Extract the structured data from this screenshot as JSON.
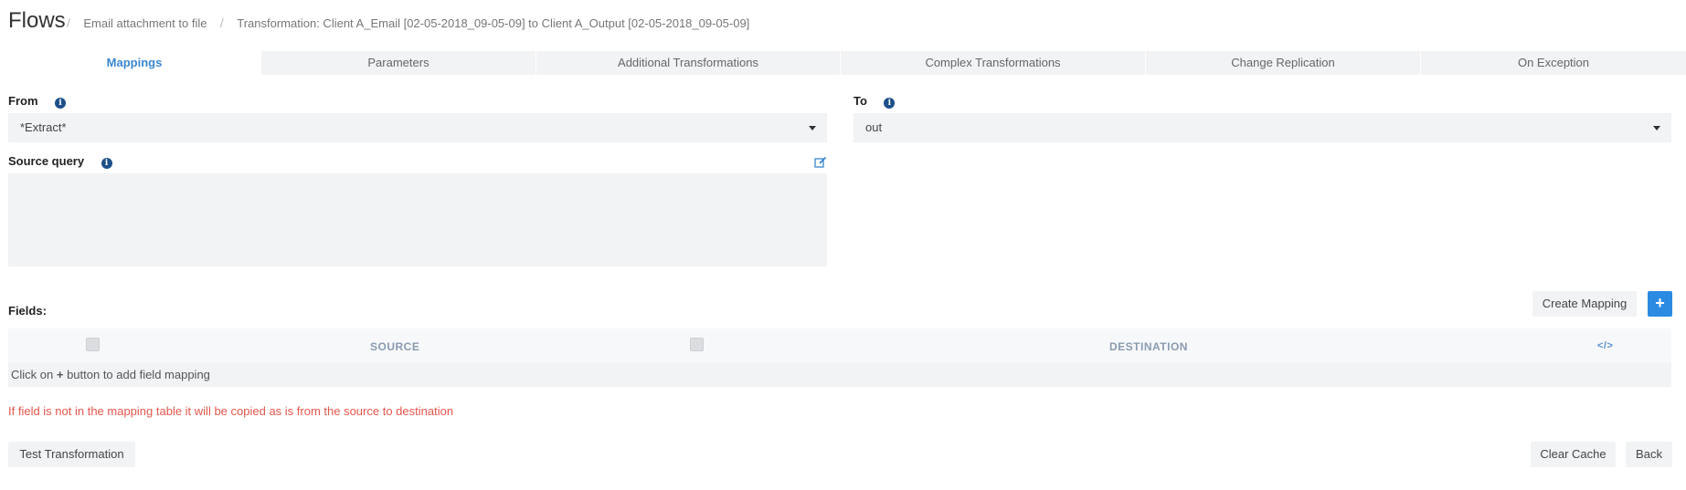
{
  "breadcrumb": {
    "title": "Flows",
    "separator": "/",
    "items": [
      "Email attachment to file",
      "Transformation: Client A_Email [02-05-2018_09-05-09] to Client A_Output [02-05-2018_09-05-09]"
    ]
  },
  "tabs": [
    {
      "label": "Mappings",
      "active": true
    },
    {
      "label": "Parameters"
    },
    {
      "label": "Additional Transformations"
    },
    {
      "label": "Complex Transformations"
    },
    {
      "label": "Change Replication"
    },
    {
      "label": "On Exception"
    }
  ],
  "from": {
    "label": "From",
    "value": "*Extract*"
  },
  "to": {
    "label": "To",
    "value": "out"
  },
  "source_query": {
    "label": "Source query",
    "value": ""
  },
  "fields": {
    "label": "Fields:",
    "create_mapping_label": "Create Mapping",
    "add_label": "+",
    "columns": {
      "source": "SOURCE",
      "destination": "DESTINATION",
      "code": "</>"
    },
    "empty_prefix": "Click on ",
    "empty_plus": "+",
    "empty_suffix": " button to add field mapping"
  },
  "warning": "If field is not in the mapping table it will be copied as is from the source to destination",
  "buttons": {
    "test": "Test Transformation",
    "clear_cache": "Clear Cache",
    "back": "Back"
  },
  "colors": {
    "accent": "#3a87cf",
    "primary_button": "#2b8ae2",
    "warning": "#e2574c"
  }
}
